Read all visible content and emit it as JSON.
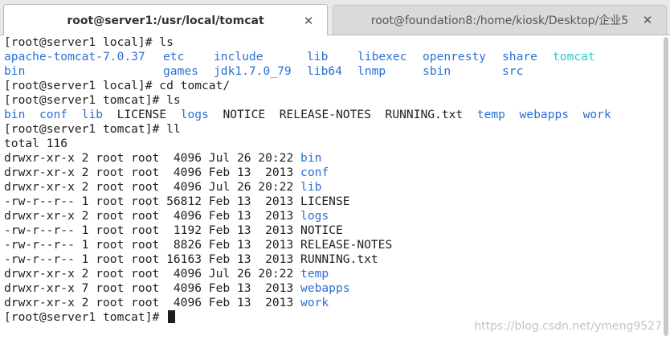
{
  "tabs": [
    {
      "label": "root@server1:/usr/local/tomcat",
      "active": true,
      "close": "✕"
    },
    {
      "label": "root@foundation8:/home/kiosk/Desktop/企业5",
      "active": false,
      "close": "✕"
    }
  ],
  "terminal": {
    "prompt_local": "[root@server1 local]# ",
    "prompt_tomcat": "[root@server1 tomcat]# ",
    "cmd_ls": "ls",
    "cmd_cd": "cd tomcat/",
    "cmd_ll": "ll",
    "local_ls_row1": [
      "apache-tomcat-7.0.37",
      "etc",
      "include",
      "lib",
      "libexec",
      "openresty",
      "share",
      "tomcat"
    ],
    "local_ls_row2": [
      "bin",
      "games",
      "jdk1.7.0_79",
      "lib64",
      "lnmp",
      "sbin",
      "src"
    ],
    "tomcat_ls": [
      "bin",
      "conf",
      "lib",
      "LICENSE",
      "logs",
      "NOTICE",
      "RELEASE-NOTES",
      "RUNNING.txt",
      "temp",
      "webapps",
      "work"
    ],
    "total": "total 116",
    "ll_rows": [
      {
        "meta": "drwxr-xr-x 2 root root  4096 Jul 26 20:22 ",
        "name": "bin"
      },
      {
        "meta": "drwxr-xr-x 2 root root  4096 Feb 13  2013 ",
        "name": "conf"
      },
      {
        "meta": "drwxr-xr-x 2 root root  4096 Jul 26 20:22 ",
        "name": "lib"
      },
      {
        "meta": "-rw-r--r-- 1 root root 56812 Feb 13  2013 ",
        "name": "LICENSE"
      },
      {
        "meta": "drwxr-xr-x 2 root root  4096 Feb 13  2013 ",
        "name": "logs"
      },
      {
        "meta": "-rw-r--r-- 1 root root  1192 Feb 13  2013 ",
        "name": "NOTICE"
      },
      {
        "meta": "-rw-r--r-- 1 root root  8826 Feb 13  2013 ",
        "name": "RELEASE-NOTES"
      },
      {
        "meta": "-rw-r--r-- 1 root root 16163 Feb 13  2013 ",
        "name": "RUNNING.txt"
      },
      {
        "meta": "drwxr-xr-x 2 root root  4096 Jul 26 20:22 ",
        "name": "temp"
      },
      {
        "meta": "drwxr-xr-x 7 root root  4096 Feb 13  2013 ",
        "name": "webapps"
      },
      {
        "meta": "drwxr-xr-x 2 root root  4096 Feb 13  2013 ",
        "name": "work"
      }
    ]
  },
  "watermark": "https://blog.csdn.net/ymeng9527",
  "colors": {
    "directory": "#2a6fd6",
    "symlink": "#29c9c9",
    "text": "#1e1e1e"
  },
  "icons": {
    "tab_close": "close-icon",
    "cursor": "block-cursor"
  }
}
